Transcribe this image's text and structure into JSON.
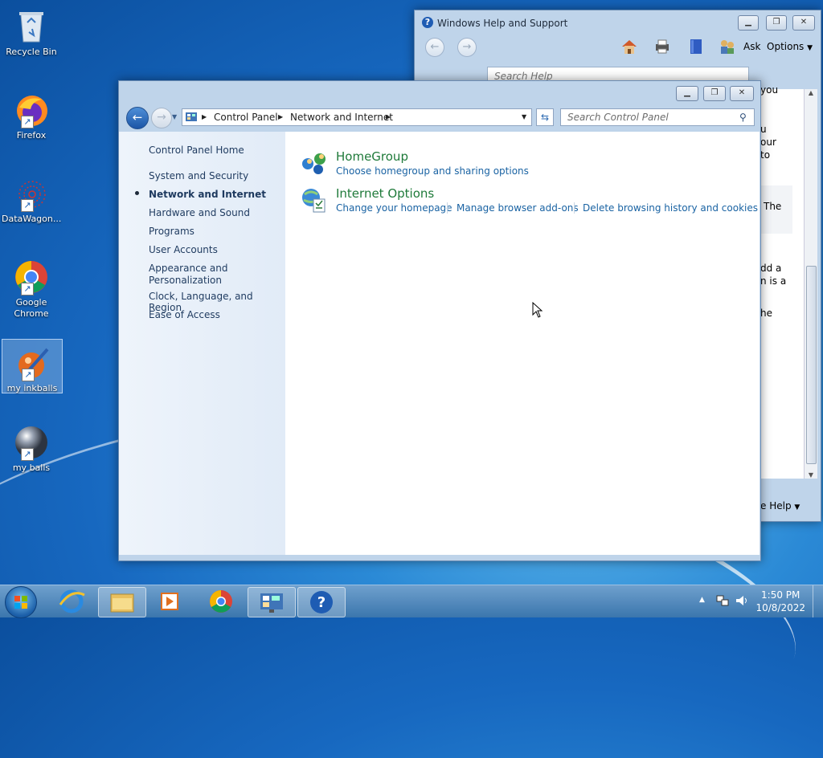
{
  "desktop": {
    "icons": [
      {
        "label": "Recycle Bin"
      },
      {
        "label": "Firefox"
      },
      {
        "label": "DataWagon..."
      },
      {
        "label": "Google Chrome"
      },
      {
        "label": "my inkballs"
      },
      {
        "label": "my balls"
      }
    ]
  },
  "help_window": {
    "title": "Windows Help and Support",
    "search_placeholder": "Search Help",
    "toolbar": {
      "ask": "Ask",
      "options": "Options"
    },
    "content_fragments": [
      "you",
      "u",
      "our",
      "to",
      "The",
      "dd a",
      "n is a",
      "he"
    ],
    "footer_help": "e Help"
  },
  "control_panel": {
    "breadcrumb": [
      "Control Panel",
      "Network and Internet"
    ],
    "search_placeholder": "Search Control Panel",
    "nav": {
      "home": "Control Panel Home",
      "items": [
        {
          "label": "System and Security"
        },
        {
          "label": "Network and Internet",
          "selected": true
        },
        {
          "label": "Hardware and Sound"
        },
        {
          "label": "Programs"
        },
        {
          "label": "User Accounts"
        },
        {
          "label": "Appearance and Personalization"
        },
        {
          "label": "Clock, Language, and Region"
        },
        {
          "label": "Ease of Access"
        }
      ]
    },
    "categories": [
      {
        "title": "HomeGroup",
        "links": [
          "Choose homegroup and sharing options"
        ]
      },
      {
        "title": "Internet Options",
        "links": [
          "Change your homepage",
          "Manage browser add-ons",
          "Delete browsing history and cookies"
        ]
      }
    ]
  },
  "taskbar": {
    "time": "1:50 PM",
    "date": "10/8/2022"
  }
}
